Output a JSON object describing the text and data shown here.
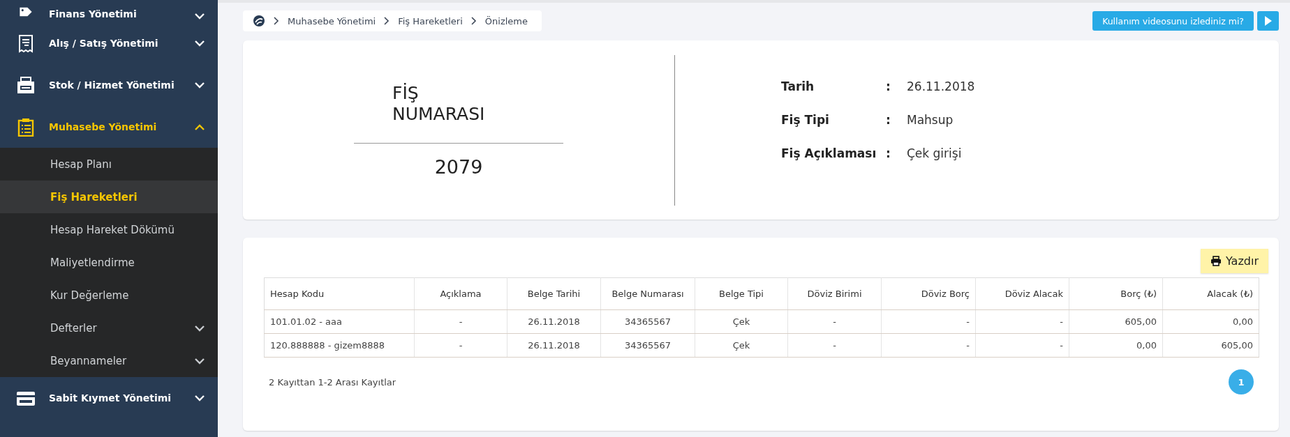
{
  "sidebar": {
    "items": [
      {
        "label": "Finans Yönetimi",
        "expanded": false
      },
      {
        "label": "Alış / Satış Yönetimi",
        "expanded": false
      },
      {
        "label": "Stok / Hizmet Yönetimi",
        "expanded": false
      },
      {
        "label": "Muhasebe Yönetimi",
        "expanded": true,
        "children": [
          {
            "label": "Hesap Planı",
            "selected": false,
            "submenu": false
          },
          {
            "label": "Fiş Hareketleri",
            "selected": true,
            "submenu": false
          },
          {
            "label": "Hesap Hareket Dökümü",
            "selected": false,
            "submenu": false
          },
          {
            "label": "Maliyetlendirme",
            "selected": false,
            "submenu": false
          },
          {
            "label": "Kur Değerleme",
            "selected": false,
            "submenu": false
          },
          {
            "label": "Defterler",
            "selected": false,
            "submenu": true
          },
          {
            "label": "Beyannameler",
            "selected": false,
            "submenu": true
          }
        ]
      },
      {
        "label": "Sabit Kıymet Yönetimi",
        "expanded": false
      }
    ]
  },
  "breadcrumb": [
    "Muhasebe Yönetimi",
    "Fiş Hareketleri",
    "Önizleme"
  ],
  "video_prompt": {
    "label": "Kullanım videosunu izlediniz mi?"
  },
  "voucher": {
    "title": "FİŞ NUMARASI",
    "number": "2079",
    "fields": [
      {
        "label": "Tarih",
        "separator": ":",
        "value": "26.11.2018"
      },
      {
        "label": "Fiş Tipi",
        "separator": ":",
        "value": "Mahsup"
      },
      {
        "label": "Fiş Açıklaması",
        "separator": ":",
        "value": "Çek girişi"
      }
    ]
  },
  "print_button": "Yazdır",
  "table": {
    "columns": [
      "Hesap Kodu",
      "Açıklama",
      "Belge Tarihi",
      "Belge Numarası",
      "Belge Tipi",
      "Döviz Birimi",
      "Döviz Borç",
      "Döviz Alacak",
      "Borç (₺)",
      "Alacak (₺)"
    ],
    "rows": [
      [
        "101.01.02 - aaa",
        "-",
        "26.11.2018",
        "34365567",
        "Çek",
        "-",
        "-",
        "-",
        "605,00",
        "0,00"
      ],
      [
        "120.888888 - gizem8888",
        "-",
        "26.11.2018",
        "34365567",
        "Çek",
        "-",
        "-",
        "-",
        "0,00",
        "605,00"
      ]
    ]
  },
  "footer": "2 Kayıttan 1-2 Arası Kayıtlar",
  "pagination": [
    {
      "label": "1",
      "selected": true
    }
  ]
}
